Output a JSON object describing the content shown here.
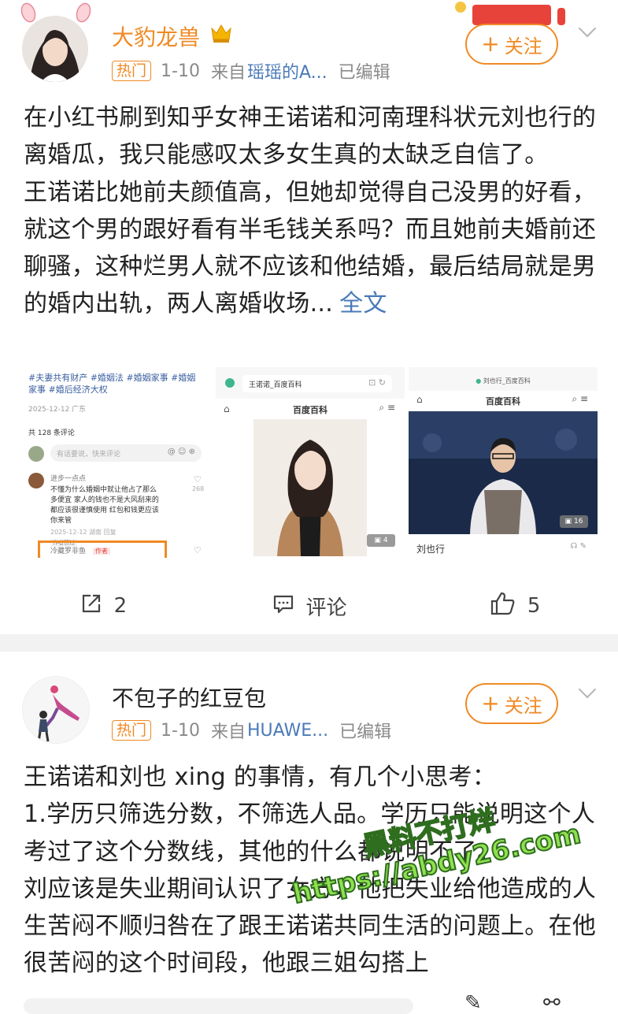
{
  "post1": {
    "username": "大豹龙兽",
    "hot_badge": "热门",
    "date": "1-10",
    "source_prefix": "来自",
    "source": "瑶瑶的A...",
    "edited": "已编辑",
    "follow_label": "关注",
    "paragraph1": "在小红书刷到知乎女神王诺诺和河南理科状元刘也行的离婚瓜，我只能感叹太多女生真的太缺乏自信了。",
    "paragraph2": "王诺诺比她前夫颜值高，但她却觉得自己没男的好看，就这个男的跟好看有半毛钱关系吗？而且她前夫婚前还聊骚，这种烂男人就不应该和他结婚，最后结局就是男的婚内出轨，两人离婚收场...",
    "more_label": "全文",
    "repost_count": "2",
    "comment_label": "评论",
    "like_count": "5",
    "image1": {
      "tags_line1": "#夫妻共有财产 #婚姻法 #婚姻家事 #婚姻",
      "tags_line2": "家事 #婚后经济大权",
      "post_date": "2025-12-12 广东",
      "comment_count": "共 128 条评论",
      "input_placeholder": "有话要说，快来评论",
      "commenter": "进步一点点",
      "comment_line1": "不懂为什么婚姻中就让他占了那么",
      "comment_line2": "多便宜 家人的钱也不是大风刮来的",
      "comment_line3": "都应该很谨慎使用 红包和钱更应该",
      "comment_line4": "你来管",
      "comment_meta": "2025-12-12 湖南 回复",
      "like_num": "268",
      "author_liked": "作者赞过",
      "reply_user": "冷藏罗非鱼",
      "author_tag": "作者"
    },
    "image2": {
      "tab_title": "王诺诺_百度百科",
      "site_title": "百度百科",
      "photo_count": "4"
    },
    "image3": {
      "tab_title": "刘也行_百度百科",
      "site_title": "百度百科",
      "photo_count": "16",
      "caption": "刘也行"
    }
  },
  "post2": {
    "username": "不包子的红豆包",
    "hot_badge": "热门",
    "date": "1-10",
    "source_prefix": "来自",
    "source": "HUAWE...",
    "edited": "已编辑",
    "follow_label": "关注",
    "line1": "王诺诺和刘也 xing 的事情，有几个小思考：",
    "line2": "1.学历只筛选分数，不筛选人品。学历只能说明这个人考过了这个分数线，其他的什么都说明不了。",
    "line3": "刘应该是失业期间认识了女方，他把失业给他造成的人生苦闷不顺归咎在了跟王诺诺共同生活的问题上。在他很苦闷的这个时间段，他跟三姐勾搭上"
  },
  "watermark": {
    "line1": "黑料不打烊",
    "line2": "https://abdy26.com"
  },
  "colors": {
    "accent": "#f08a24",
    "link": "#4a7ab8",
    "muted": "#8a8a8a"
  }
}
